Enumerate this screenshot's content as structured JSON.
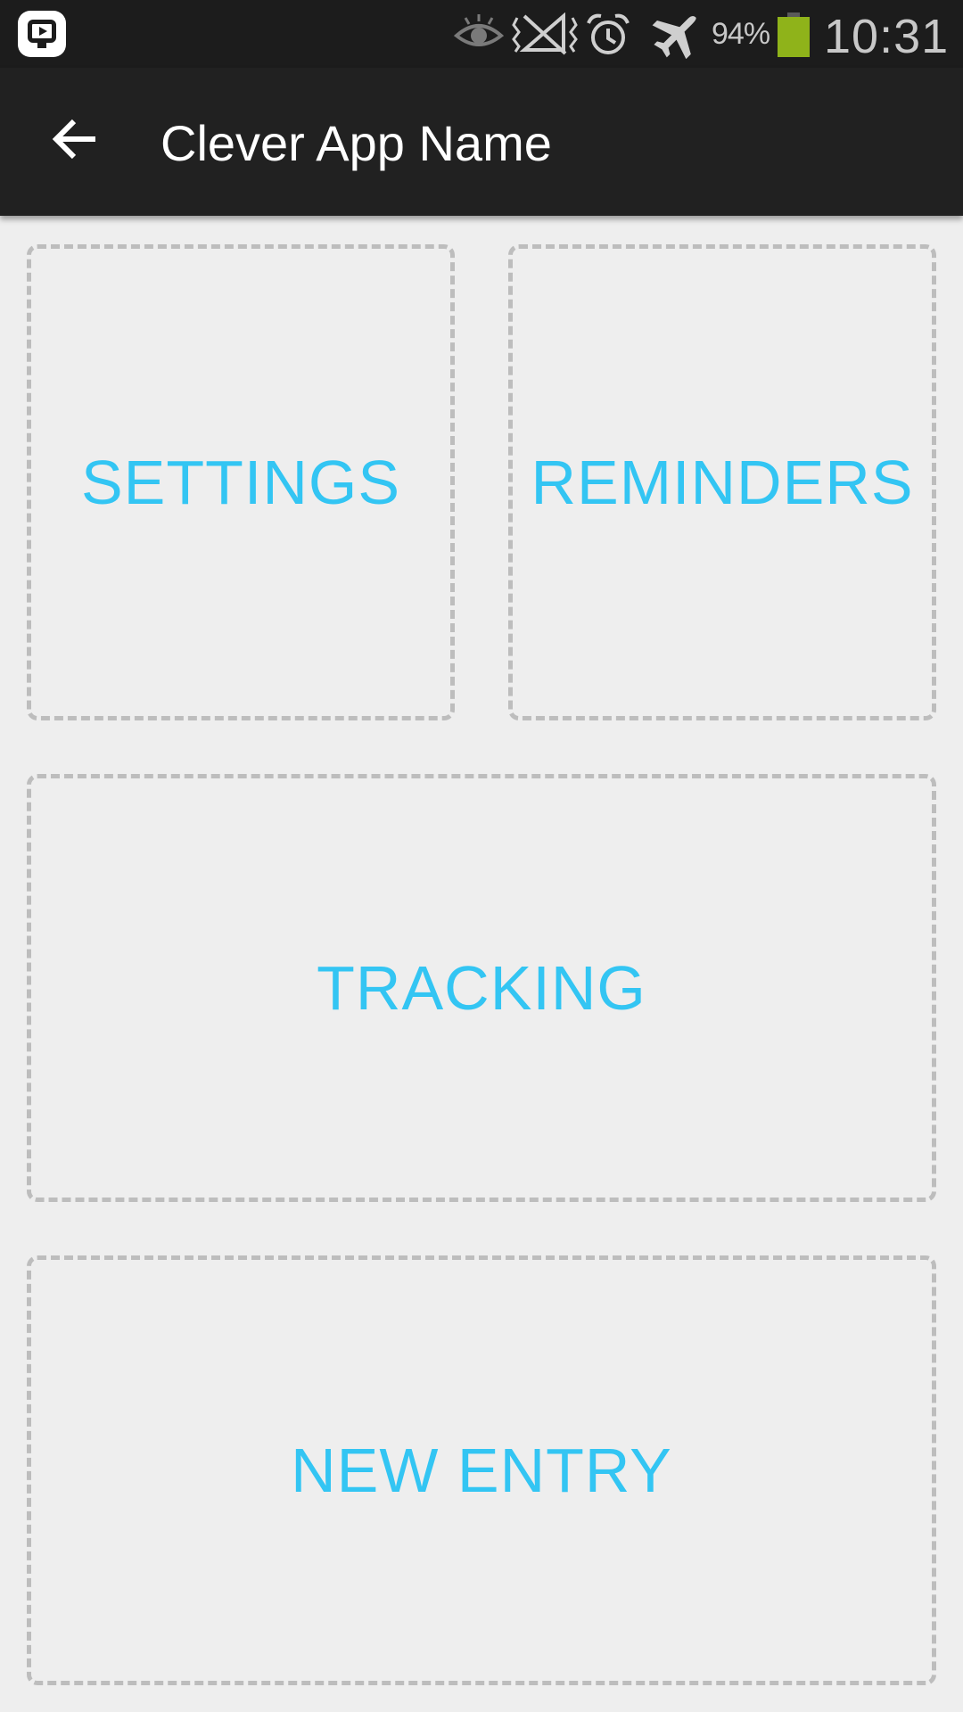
{
  "status_bar": {
    "battery_percent": "94%",
    "time": "10:31",
    "icons": [
      "app-notification-icon",
      "eye-icon",
      "no-signal-icon",
      "alarm-icon",
      "airplane-mode-icon",
      "battery-icon"
    ],
    "battery_color": "#8fb31a"
  },
  "app_bar": {
    "back_icon": "arrow-left-icon",
    "title": "Clever App Name"
  },
  "tiles": [
    {
      "label": "SETTINGS"
    },
    {
      "label": "REMINDERS"
    },
    {
      "label": "TRACKING"
    },
    {
      "label": "NEW ENTRY"
    }
  ],
  "colors": {
    "accent": "#33c5f3",
    "app_bar_bg": "#212121",
    "status_bar_bg": "#1c1c1c",
    "page_bg": "#eeeeee",
    "tile_border": "#bdbdbd"
  }
}
